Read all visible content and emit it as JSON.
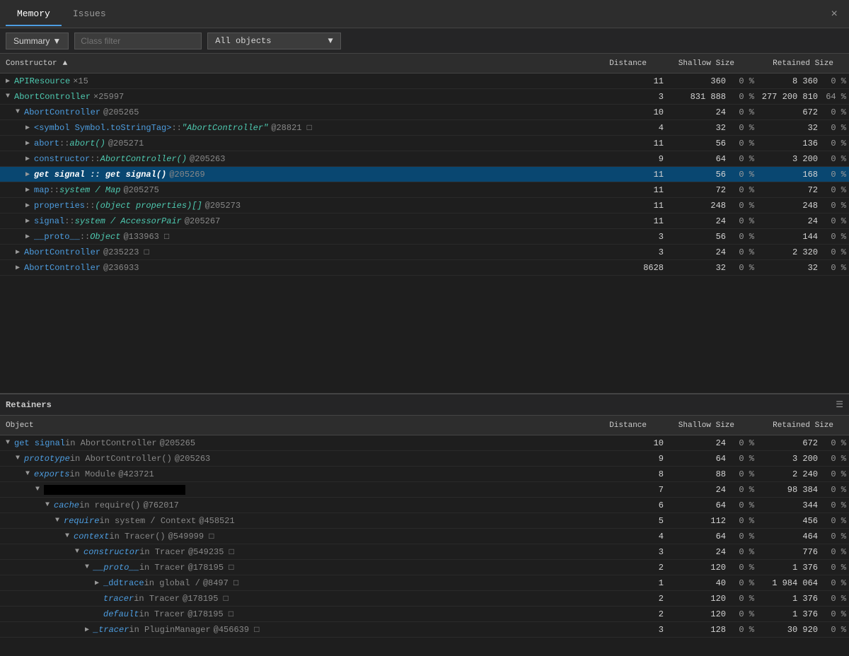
{
  "tabs": [
    {
      "label": "Memory",
      "active": true
    },
    {
      "label": "Issues",
      "active": false
    }
  ],
  "close_label": "×",
  "toolbar": {
    "summary_label": "Summary",
    "class_filter_placeholder": "Class filter",
    "all_objects_label": "All objects"
  },
  "upper_table": {
    "headers": [
      "Constructor",
      "Distance",
      "Shallow Size",
      "Retained Size"
    ],
    "rows": [
      {
        "indent": 0,
        "arrow": "▶",
        "name": "APIResource",
        "count": "×15",
        "addr": "",
        "distance": "11",
        "shallow": "360",
        "shallow_pct": "0 %",
        "retained": "8 360",
        "retained_pct": "0 %",
        "selected": false
      },
      {
        "indent": 0,
        "arrow": "▼",
        "name": "AbortController",
        "count": "×25997",
        "addr": "",
        "distance": "3",
        "shallow": "831 888",
        "shallow_pct": "0 %",
        "retained": "277 200 810",
        "retained_pct": "64 %",
        "selected": false
      },
      {
        "indent": 1,
        "arrow": "▼",
        "name": "AbortController",
        "count": "",
        "addr": "@205265",
        "distance": "10",
        "shallow": "24",
        "shallow_pct": "0 %",
        "retained": "672",
        "retained_pct": "0 %",
        "selected": false
      },
      {
        "indent": 2,
        "arrow": "▶",
        "name": "<symbol Symbol.toStringTag> :: \"AbortController\"",
        "count": "",
        "addr": "@28821 □",
        "distance": "4",
        "shallow": "32",
        "shallow_pct": "0 %",
        "retained": "32",
        "retained_pct": "0 %",
        "selected": false
      },
      {
        "indent": 2,
        "arrow": "▶",
        "name": "abort :: abort()",
        "count": "",
        "addr": "@205271",
        "distance": "11",
        "shallow": "56",
        "shallow_pct": "0 %",
        "retained": "136",
        "retained_pct": "0 %",
        "selected": false
      },
      {
        "indent": 2,
        "arrow": "▶",
        "name": "constructor :: AbortController()",
        "count": "",
        "addr": "@205263",
        "distance": "9",
        "shallow": "64",
        "shallow_pct": "0 %",
        "retained": "3 200",
        "retained_pct": "0 %",
        "selected": false
      },
      {
        "indent": 2,
        "arrow": "▶",
        "name": "get signal :: get signal()",
        "count": "",
        "addr": "@205269",
        "distance": "11",
        "shallow": "56",
        "shallow_pct": "0 %",
        "retained": "168",
        "retained_pct": "0 %",
        "selected": true
      },
      {
        "indent": 2,
        "arrow": "▶",
        "name": "map :: system / Map",
        "count": "",
        "addr": "@205275",
        "distance": "11",
        "shallow": "72",
        "shallow_pct": "0 %",
        "retained": "72",
        "retained_pct": "0 %",
        "selected": false
      },
      {
        "indent": 2,
        "arrow": "▶",
        "name": "properties :: (object properties)[]",
        "count": "",
        "addr": "@205273",
        "distance": "11",
        "shallow": "248",
        "shallow_pct": "0 %",
        "retained": "248",
        "retained_pct": "0 %",
        "selected": false
      },
      {
        "indent": 2,
        "arrow": "▶",
        "name": "signal :: system / AccessorPair",
        "count": "",
        "addr": "@205267",
        "distance": "11",
        "shallow": "24",
        "shallow_pct": "0 %",
        "retained": "24",
        "retained_pct": "0 %",
        "selected": false
      },
      {
        "indent": 2,
        "arrow": "▶",
        "name": "__proto__ :: Object",
        "count": "",
        "addr": "@133963 □",
        "distance": "3",
        "shallow": "56",
        "shallow_pct": "0 %",
        "retained": "144",
        "retained_pct": "0 %",
        "selected": false
      },
      {
        "indent": 1,
        "arrow": "▶",
        "name": "AbortController",
        "count": "",
        "addr": "@235223 □",
        "distance": "3",
        "shallow": "24",
        "shallow_pct": "0 %",
        "retained": "2 320",
        "retained_pct": "0 %",
        "selected": false
      },
      {
        "indent": 1,
        "arrow": "▶",
        "name": "AbortController",
        "count": "",
        "addr": "@236933",
        "distance": "8628",
        "shallow": "32",
        "shallow_pct": "0 %",
        "retained": "32",
        "retained_pct": "0 %",
        "selected": false
      }
    ]
  },
  "lower_table": {
    "title": "Retainers",
    "headers": [
      "Object",
      "Distance",
      "Shallow Size",
      "Retained Size"
    ],
    "rows": [
      {
        "indent": 0,
        "arrow": "▼",
        "name": "get signal in AbortController",
        "addr": "@205265",
        "distance": "10",
        "shallow": "24",
        "shallow_pct": "0 %",
        "retained": "672",
        "retained_pct": "0 %"
      },
      {
        "indent": 1,
        "arrow": "▼",
        "name": "prototype in AbortController()",
        "addr": "@205263",
        "distance": "9",
        "shallow": "64",
        "shallow_pct": "0 %",
        "retained": "3 200",
        "retained_pct": "0 %"
      },
      {
        "indent": 2,
        "arrow": "▼",
        "name": "exports in Module",
        "addr": "@423721",
        "distance": "8",
        "shallow": "88",
        "shallow_pct": "0 %",
        "retained": "2 240",
        "retained_pct": "0 %"
      },
      {
        "indent": 3,
        "arrow": "▼",
        "name": "",
        "addr": "",
        "distance": "7",
        "shallow": "24",
        "shallow_pct": "0 %",
        "retained": "98 384",
        "retained_pct": "0 %",
        "blacked": true
      },
      {
        "indent": 4,
        "arrow": "▼",
        "name": "cache in require()",
        "addr": "@762017",
        "distance": "6",
        "shallow": "64",
        "shallow_pct": "0 %",
        "retained": "344",
        "retained_pct": "0 %"
      },
      {
        "indent": 5,
        "arrow": "▼",
        "name": "require in system / Context",
        "addr": "@458521",
        "distance": "5",
        "shallow": "112",
        "shallow_pct": "0 %",
        "retained": "456",
        "retained_pct": "0 %"
      },
      {
        "indent": 6,
        "arrow": "▼",
        "name": "context in Tracer()",
        "addr": "@549999 □",
        "distance": "4",
        "shallow": "64",
        "shallow_pct": "0 %",
        "retained": "464",
        "retained_pct": "0 %"
      },
      {
        "indent": 7,
        "arrow": "▼",
        "name": "constructor in Tracer",
        "addr": "@549235 □",
        "distance": "3",
        "shallow": "24",
        "shallow_pct": "0 %",
        "retained": "776",
        "retained_pct": "0 %"
      },
      {
        "indent": 8,
        "arrow": "▼",
        "name": "__proto__ in Tracer",
        "addr": "@178195 □",
        "distance": "2",
        "shallow": "120",
        "shallow_pct": "0 %",
        "retained": "1 376",
        "retained_pct": "0 %"
      },
      {
        "indent": 9,
        "arrow": "▶",
        "name": "_ddtrace in global /",
        "addr": "@8497 □",
        "distance": "1",
        "shallow": "40",
        "shallow_pct": "0 %",
        "retained": "1 984 064",
        "retained_pct": "0 %"
      },
      {
        "indent": 9,
        "arrow": "",
        "name": "tracer in Tracer",
        "addr": "@178195 □",
        "distance": "2",
        "shallow": "120",
        "shallow_pct": "0 %",
        "retained": "1 376",
        "retained_pct": "0 %"
      },
      {
        "indent": 9,
        "arrow": "",
        "name": "default in Tracer",
        "addr": "@178195 □",
        "distance": "2",
        "shallow": "120",
        "shallow_pct": "0 %",
        "retained": "1 376",
        "retained_pct": "0 %"
      },
      {
        "indent": 8,
        "arrow": "▶",
        "name": "_tracer in PluginManager",
        "addr": "@456639 □",
        "distance": "3",
        "shallow": "128",
        "shallow_pct": "0 %",
        "retained": "30 920",
        "retained_pct": "0 %"
      }
    ]
  }
}
